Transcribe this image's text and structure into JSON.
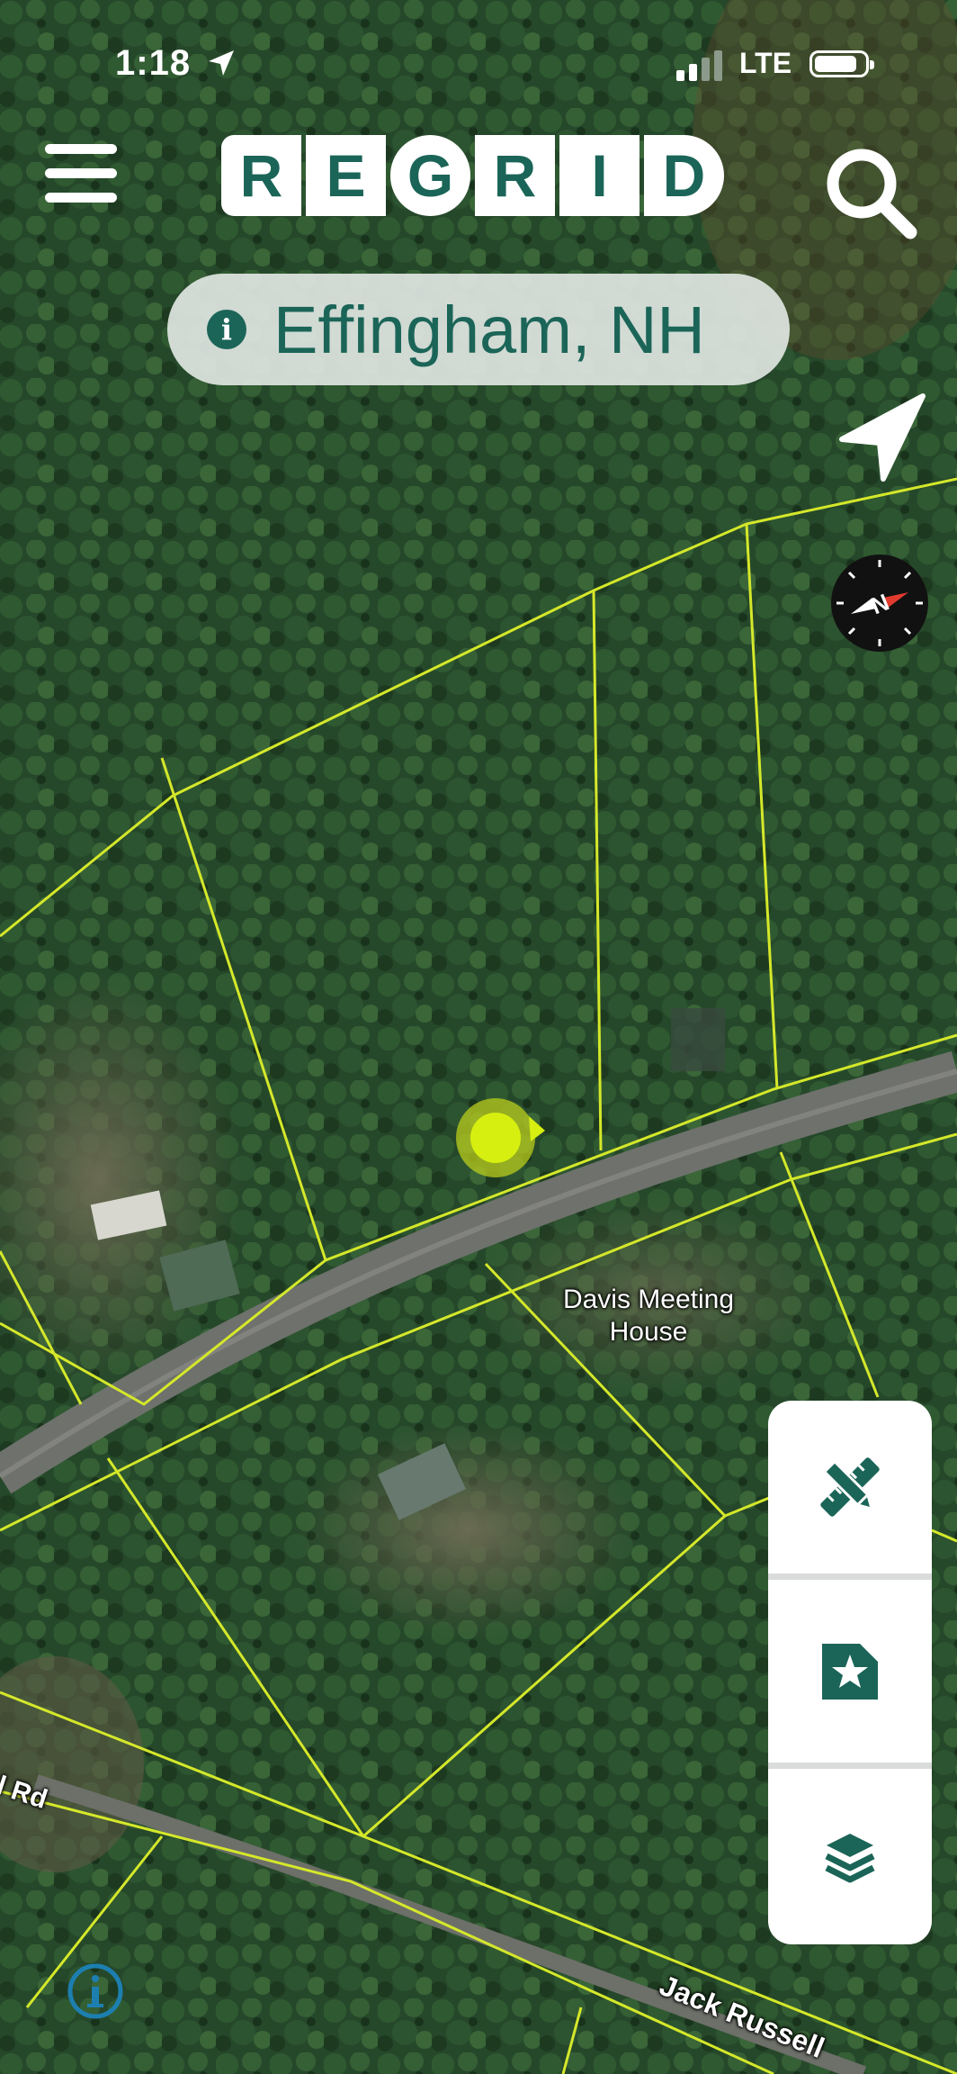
{
  "status_bar": {
    "time": "1:18",
    "network": "LTE"
  },
  "header": {
    "logo_letters": [
      "R",
      "E",
      "G",
      "R",
      "I",
      "D"
    ]
  },
  "location": {
    "name": "Effingham, NH"
  },
  "map": {
    "place_label": "Davis Meeting House",
    "road_labels": [
      "l Rd",
      "Jack Russell"
    ],
    "parcel_line_color": "#d5e82a",
    "marker_color": "#d7ef10"
  },
  "icons": {
    "menu": "hamburger-menu-icon",
    "search": "search-icon",
    "navigation": "location-arrow-icon",
    "compass": "compass-icon",
    "draw": "pencil-ruler-icon",
    "saved": "bookmark-star-icon",
    "layers": "layers-icon",
    "attribution": "info-circle-icon"
  },
  "colors": {
    "brand": "#1b6558",
    "panel": "#ffffff"
  }
}
